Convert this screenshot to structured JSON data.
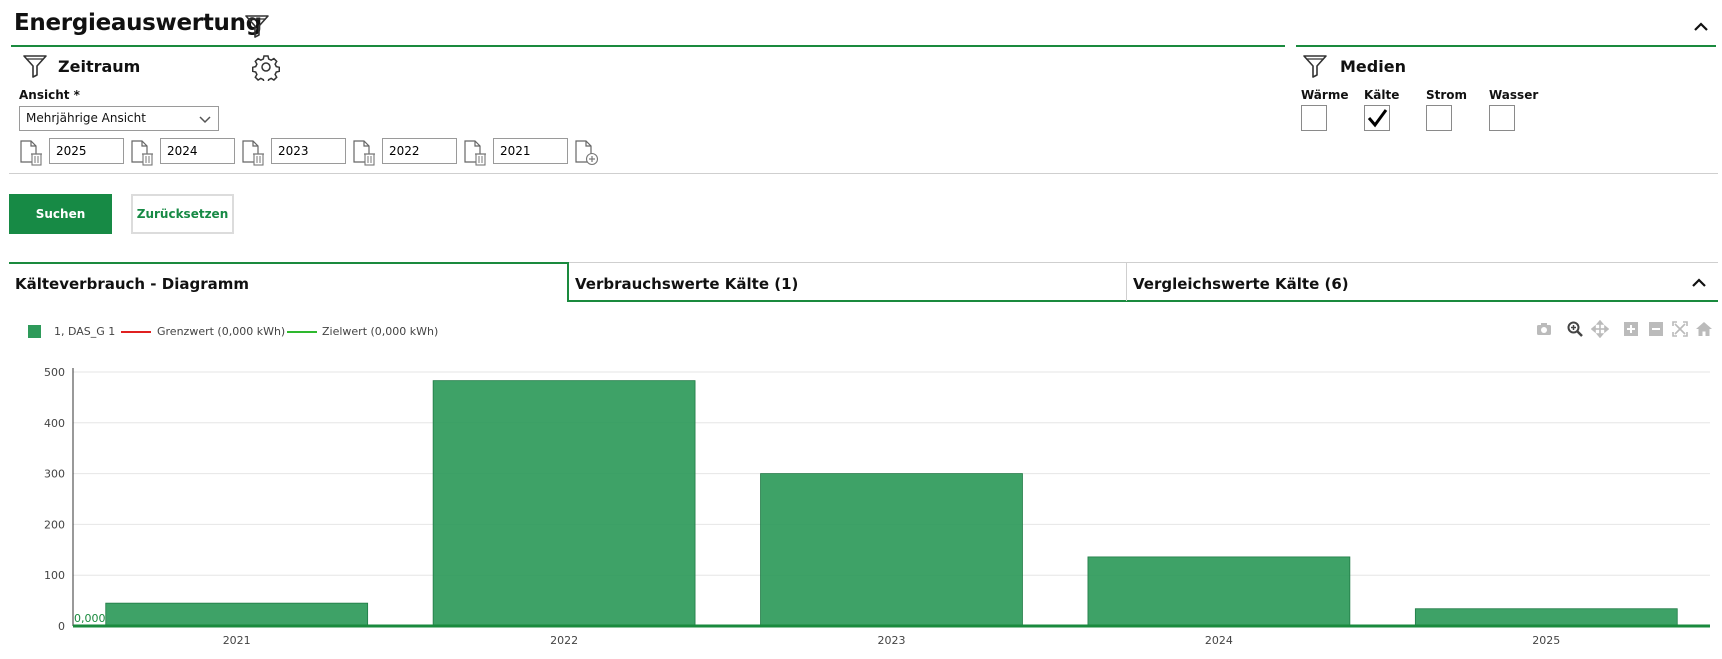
{
  "page": {
    "title": "Energieauswertung"
  },
  "zeitraum": {
    "title": "Zeitraum",
    "ansicht_label": "Ansicht *",
    "ansicht_value": "Mehrjährige Ansicht",
    "years": [
      "2025",
      "2024",
      "2023",
      "2022",
      "2021"
    ]
  },
  "medien": {
    "title": "Medien",
    "items": [
      {
        "label": "Wärme",
        "checked": false
      },
      {
        "label": "Kälte",
        "checked": true
      },
      {
        "label": "Strom",
        "checked": false
      },
      {
        "label": "Wasser",
        "checked": false
      }
    ]
  },
  "actions": {
    "search_label": "Suchen",
    "reset_label": "Zurücksetzen"
  },
  "tabs": [
    {
      "label": "Kälteverbrauch - Diagramm",
      "active": true
    },
    {
      "label": "Verbrauchswerte Kälte (1)",
      "active": false
    },
    {
      "label": "Vergleichswerte Kälte (6)",
      "active": false
    }
  ],
  "colors": {
    "accent": "#178a45",
    "bar": "#2e9a5a",
    "limit": "#e02020",
    "target": "#2eb82e"
  },
  "chart_data": {
    "type": "bar",
    "categories": [
      "2021",
      "2022",
      "2023",
      "2024",
      "2025"
    ],
    "series": [
      {
        "name": "1, DAS_G 1",
        "values": [
          45,
          483,
          300,
          136,
          34
        ]
      }
    ],
    "lines": [
      {
        "name": "Grenzwert (0,000 kWh)",
        "value": 0
      },
      {
        "name": "Zielwert (0,000 kWh)",
        "value": 0
      }
    ],
    "zero_annotation": "0,000",
    "yticks": [
      "0",
      "100",
      "200",
      "300",
      "400",
      "500"
    ],
    "ylim": [
      0,
      500
    ],
    "grid": true,
    "legend": "top-left"
  }
}
